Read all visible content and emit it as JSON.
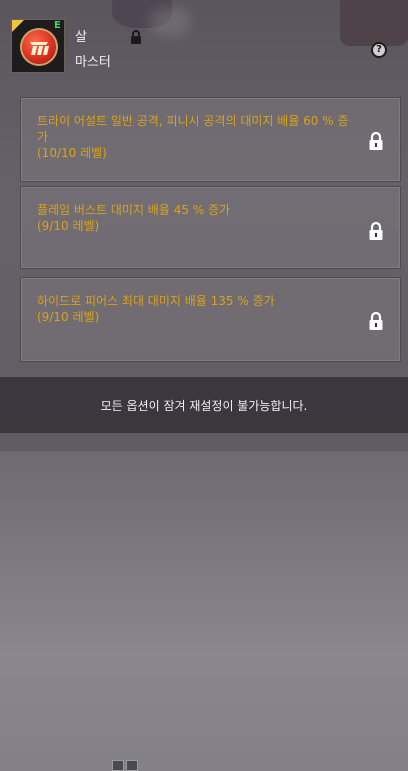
{
  "skill": {
    "name": "살",
    "grade": "E",
    "level": "마스터",
    "icon": "skill-emblem-icon"
  },
  "options": [
    {
      "effect": "트라이 어설트 일반 공격, 피니시 공격의 대미지 배율 60 % 증가",
      "level": "(10/10 레벨)",
      "locked": true
    },
    {
      "effect": "플레임 버스트 대미지 배율 45 % 증가",
      "level": "(9/10 레벨)",
      "locked": true
    },
    {
      "effect": "하이드로 피어스 최대 대미지 배율 135 % 증가",
      "level": "(9/10 레벨)",
      "locked": true
    }
  ],
  "notice": "모든 옵션이 잠겨 재설정이 불가능합니다.",
  "help_label": "?",
  "colors": {
    "option_text": "#d9a21c",
    "grade": "#3fd36a"
  }
}
